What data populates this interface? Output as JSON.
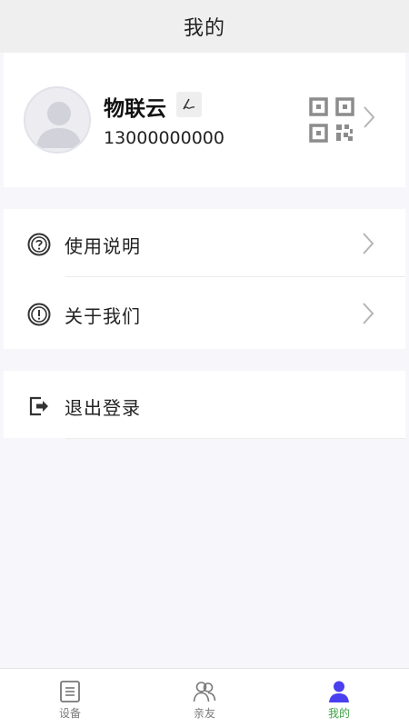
{
  "header": {
    "title": "我的"
  },
  "profile": {
    "name": "物联云",
    "phone": "13000000000",
    "icons": {
      "avatar": "avatar-placeholder-icon",
      "edit": "signature-edit-icon",
      "qr": "qr-code-icon",
      "chevron": "chevron-right-icon"
    }
  },
  "menu": {
    "group1": [
      {
        "label": "使用说明",
        "icon": "help-circle-icon"
      },
      {
        "label": "关于我们",
        "icon": "info-circle-icon"
      }
    ],
    "group2": [
      {
        "label": "退出登录",
        "icon": "logout-icon"
      }
    ]
  },
  "tabbar": {
    "items": [
      {
        "label": "设备",
        "icon": "list-icon",
        "active": false
      },
      {
        "label": "亲友",
        "icon": "contacts-icon",
        "active": false
      },
      {
        "label": "我的",
        "icon": "user-icon",
        "active": true
      }
    ]
  },
  "colors": {
    "accent": "#3fa147",
    "active_icon": "#4a3ff0",
    "header_bg": "#efefef",
    "page_bg": "#f7f6fa"
  }
}
